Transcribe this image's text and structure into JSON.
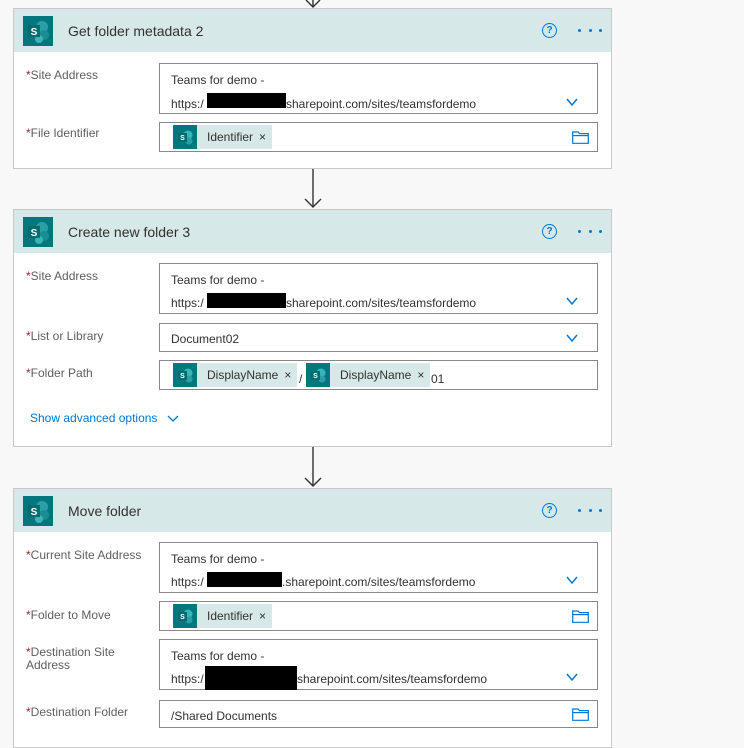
{
  "card1": {
    "title": "Get folder metadata 2",
    "site_label": "Site Address",
    "site_line1": "Teams for demo -",
    "site_prefix": "https:/",
    "site_suffix": "sharepoint.com/sites/teamsfordemo",
    "file_label": "File Identifier",
    "file_token": "Identifier"
  },
  "card2": {
    "title": "Create new folder 3",
    "site_label": "Site Address",
    "site_line1": "Teams for demo -",
    "site_prefix": "https:/",
    "site_suffix": "sharepoint.com/sites/teamsfordemo",
    "list_label": "List or Library",
    "list_value": "Document02",
    "path_label": "Folder Path",
    "path_token1": "DisplayName",
    "path_sep": "/",
    "path_token2": "DisplayName",
    "path_suffix": "01",
    "advanced": "Show advanced options"
  },
  "card3": {
    "title": "Move folder",
    "current_label": "Current Site Address",
    "current_line1": "Teams for demo -",
    "current_prefix": "https:/",
    "current_suffix": ".sharepoint.com/sites/teamsfordemo",
    "move_label": "Folder to Move",
    "move_token": "Identifier",
    "dest_label_l1": "Destination Site",
    "dest_label_l2": "Address",
    "dest_line1": "Teams for demo -",
    "dest_prefix": "https:/",
    "dest_suffix": "sharepoint.com/sites/teamsfordemo",
    "dest_folder_label": "Destination Folder",
    "dest_folder_value": "/Shared Documents"
  },
  "required_mark": "*",
  "token_close": "×",
  "icons": {
    "sharepoint": "sharepoint-icon",
    "help": "help-icon",
    "more": "more-options-icon",
    "chevron": "chevron-down-icon",
    "folder": "folder-icon",
    "arrow": "arrow-down-icon"
  },
  "colors": {
    "header_bg": "#d6e8e8",
    "sharepoint_teal": "#03787c",
    "accent": "#0078d4",
    "required": "#a4262c"
  }
}
